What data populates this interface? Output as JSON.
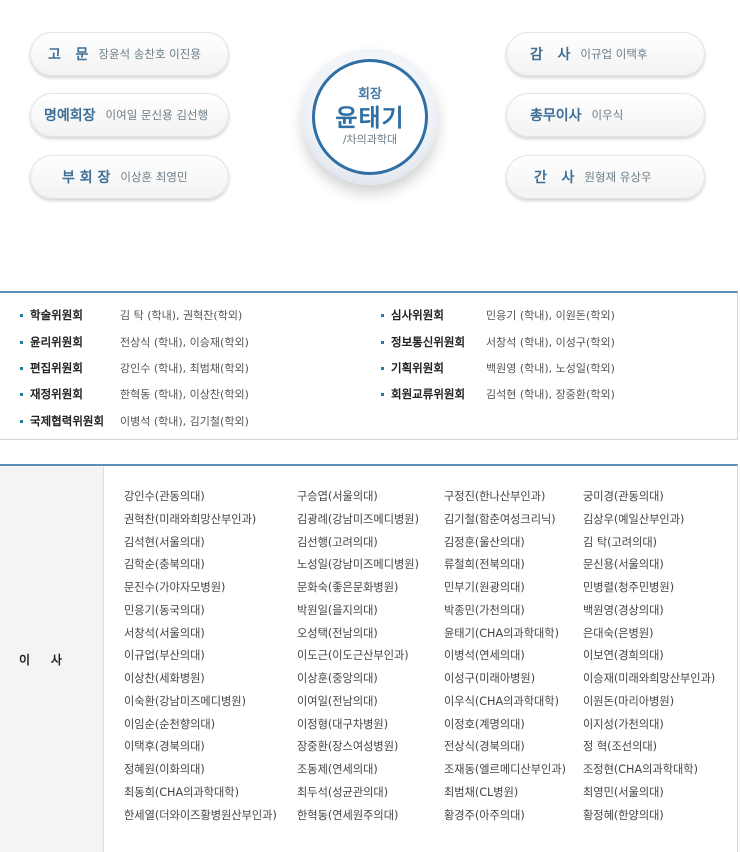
{
  "officers_left": [
    {
      "role": "고   문",
      "names": "장윤석 송찬호 이진용"
    },
    {
      "role": "명예회장",
      "names": "이여일 문신용 김선행"
    },
    {
      "role": "부 회 장",
      "names": "이상훈 최영민"
    }
  ],
  "officers_right": [
    {
      "role": "감   사",
      "names": "이규업 이택후"
    },
    {
      "role": "총무이사",
      "names": "이우식"
    },
    {
      "role": "간   사",
      "names": "원형재 유상우"
    }
  ],
  "president": {
    "title": "회장",
    "name": "윤태기",
    "affiliation": "/차의과학대"
  },
  "committees": [
    {
      "name": "학술위원회",
      "members": "김   탁 (학내), 권혁찬(학외)"
    },
    {
      "name": "심사위원회",
      "members": "민응기 (학내), 이원돈(학외)"
    },
    {
      "name": "윤리위원회",
      "members": "전상식 (학내), 이승재(학외)"
    },
    {
      "name": "정보통신위원회",
      "members": "서창석 (학내), 이성구(학외)"
    },
    {
      "name": "편집위원회",
      "members": "강인수 (학내), 최범채(학외)"
    },
    {
      "name": "기획위원회",
      "members": "백원영 (학내), 노성일(학외)"
    },
    {
      "name": "재정위원회",
      "members": "한혁동 (학내), 이상찬(학외)"
    },
    {
      "name": "회원교류위원회",
      "members": "김석현 (학내), 장중환(학외)"
    },
    {
      "name": "국제협력위원회",
      "members": "이병석 (학내), 김기철(학외)"
    }
  ],
  "board_label": "이     사",
  "directors": [
    [
      "강인수(관동의대)",
      "구승엽(서울의대)",
      "구정진(한나산부인과)",
      "궁미경(관동의대)"
    ],
    [
      "권혁찬(미래와희망산부인과)",
      "김광례(강남미즈메디병원)",
      "김기철(함춘여성크리닉)",
      "김상우(예일산부인과)"
    ],
    [
      "김석현(서울의대)",
      "김선행(고려의대)",
      "김정훈(울산의대)",
      "김 탁(고려의대)"
    ],
    [
      "김학순(충북의대)",
      "노성일(강남미즈메디병원)",
      "류철희(전북의대)",
      "문신용(서울의대)"
    ],
    [
      "문진수(가야자모병원)",
      "문화숙(좋은문화병원)",
      "민부기(원광의대)",
      "민병렬(청주민병원)"
    ],
    [
      "민응기(동국의대)",
      "박원일(을지의대)",
      "박종민(가천의대)",
      "백원영(경상의대)"
    ],
    [
      "서창석(서울의대)",
      "오성택(전남의대)",
      "윤태기(CHA의과학대학)",
      "은대숙(은병원)"
    ],
    [
      "이규업(부산의대)",
      "이도근(이도근산부인과)",
      "이병석(연세의대)",
      "이보연(경희의대)"
    ],
    [
      "이상찬(세화병원)",
      "이상훈(중앙의대)",
      "이성구(미래아병원)",
      "이승재(미래와희망산부인과)"
    ],
    [
      "이숙환(강남미즈메디병원)",
      "이여일(전남의대)",
      "이우식(CHA의과학대학)",
      "이원돈(마리아병원)"
    ],
    [
      "이임순(순천향의대)",
      "이정형(대구차병원)",
      "이정호(계명의대)",
      "이지성(가천의대)"
    ],
    [
      "이택후(경북의대)",
      "장중환(장스여성병원)",
      "전상식(경북의대)",
      "정 혁(조선의대)"
    ],
    [
      "정혜원(이화의대)",
      "조동제(연세의대)",
      "조재동(엘르메디산부인과)",
      "조정현(CHA의과학대학)"
    ],
    [
      "최동희(CHA의과학대학)",
      "최두석(성균관의대)",
      "최범채(CL병원)",
      "최영민(서울의대)"
    ],
    [
      "한세열(더와이즈황병원산부인과)",
      "한혁동(연세원주의대)",
      "황경주(아주의대)",
      "황정혜(한양의대)"
    ]
  ]
}
